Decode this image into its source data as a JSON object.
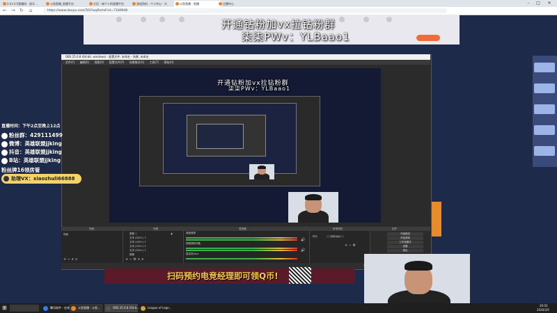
{
  "browser": {
    "tabs": [
      "2.0×3.0直播间 - 虎牙...",
      "斗鱼直播_直播平台",
      "大话 - 每个人的直播平台",
      "游戏资料 - 个人中心 - 大",
      "斗鱼直播 - 直播",
      "主播中心"
    ],
    "url": "https://www.douyu.com/TcD?wqPartxFrid=7180948"
  },
  "overlay": {
    "line1": "开通钻粉加vx拉钻粉群",
    "line2": "柒柒PWv：YLBaao1"
  },
  "left_panel": {
    "schedule": "直播时间：下午2点至晚上12点",
    "qq_group": "粉丝群：429111499",
    "weibo": "微博：英雄联盟jjking",
    "douyin": "抖音：英雄联盟jjking",
    "bilibili": "B站：英雄联盟jjking",
    "fan_badge": "粉丝牌16领房管",
    "wechat": "助理VX：xiaozhuli66888"
  },
  "obs": {
    "title": "OBS 25.0.8 (64-bit, windows) - 配置文件: 未命名 - 场景: 未命名",
    "menu": [
      "文件(F)",
      "编辑(E)",
      "视图(V)",
      "配置文件(P)",
      "场景集合(S)",
      "工具(T)",
      "帮助(H)"
    ],
    "docks": [
      "场景",
      "来源",
      "混音器",
      "转场特效",
      "控件"
    ],
    "scene_item": "场景",
    "sources": [
      "图像 1",
      "文本 (GDI+) 3",
      "文本 (GDI+) 2",
      "文本 (GDI+) 4",
      "文本 (GDI+) 1",
      "图像"
    ],
    "mixer": [
      "桌面音频",
      "视频捕获设备",
      "麦克风/Aux"
    ],
    "transition_label": "时长",
    "transition_value": "300 ms",
    "controls": [
      "开始推流",
      "开始录制",
      "工作室模式",
      "设置",
      "退出"
    ],
    "status": "LIVE: 00:00:00  REC: 00:00:00  CPU: 3.6%, 30.00 fps"
  },
  "banner": {
    "text": "扫码预约电竞经理即可领Q币!"
  },
  "taskbar": {
    "search": "",
    "items": [
      "腾讯软件 - 在线...",
      "斗鱼直播 - 斗鱼...",
      "OBS 25.0.8 (64-b...",
      "League of Lege..."
    ],
    "time": "20:03",
    "date": "2020/3/5"
  },
  "colors": {
    "accent": "#f26b3a",
    "wechat_bg": "#f4d36a",
    "overlay_text": "#ffffff"
  }
}
